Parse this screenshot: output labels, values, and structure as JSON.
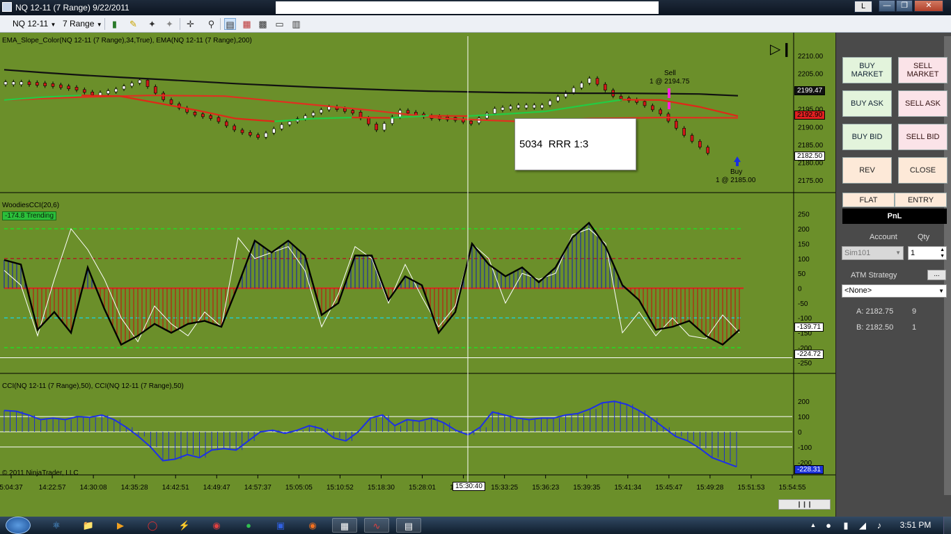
{
  "window": {
    "title": "NQ 12-11 (7 Range)  9/22/2011",
    "btn_l": "L"
  },
  "toolbar": {
    "instrument": "NQ 12-11",
    "period": "7 Range"
  },
  "price_panel": {
    "title": "EMA_Slope_Color(NQ 12-11 (7 Range),34,True), EMA(NQ 12-11 (7 Range),200)",
    "ticks": [
      "2210.00",
      "2205.00",
      "2200.00",
      "2195.00",
      "2190.00",
      "2185.00",
      "2180.00",
      "2175.00"
    ],
    "badge_ema200": "2199.47",
    "badge_ema34": "2192.90",
    "badge_last": "2182.50",
    "sell_label": "Sell",
    "sell_detail": "1 @ 2194.75",
    "buy_label": "Buy",
    "buy_detail": "1 @ 2185.00",
    "note_box": "5034  RRR 1:3"
  },
  "cci_panel": {
    "title": "WoodiesCCI(20,6)",
    "trend_badge": "-174.8 Trending",
    "ticks": [
      "250",
      "200",
      "150",
      "100",
      "50",
      "0",
      "-50",
      "-100",
      "-150",
      "-200",
      "-250"
    ],
    "badge_value": "-139.71",
    "badge_low": "-224.72"
  },
  "cci2_panel": {
    "title": "CCI(NQ 12-11 (7 Range),50), CCI(NQ 12-11 (7 Range),50)",
    "ticks": [
      "200",
      "100",
      "0",
      "-100",
      "-200"
    ],
    "badge_value": "-228.31",
    "copyright": "© 2011 NinjaTrader, LLC"
  },
  "time_axis": {
    "labels": [
      "5:04:37",
      "14:22:57",
      "14:30:08",
      "14:35:28",
      "14:42:51",
      "14:49:47",
      "14:57:37",
      "15:05:05",
      "15:10:52",
      "15:18:30",
      "15:28:01",
      "15:30:00",
      "15:33:25",
      "15:36:23",
      "15:39:35",
      "15:41:34",
      "15:45:47",
      "15:49:28",
      "15:51:53",
      "15:54:55"
    ],
    "cursor_label": "15:30:40"
  },
  "order_panel": {
    "buy_market": "BUY\nMARKET",
    "sell_market": "SELL\nMARKET",
    "buy_ask": "BUY ASK",
    "sell_ask": "SELL ASK",
    "buy_bid": "BUY BID",
    "sell_bid": "SELL BID",
    "rev": "REV",
    "close": "CLOSE",
    "flat": "FLAT",
    "entry": "ENTRY",
    "pnl": "PnL",
    "account_label": "Account",
    "account_value": "Sim101",
    "qty_label": "Qty",
    "qty_value": "1",
    "atm_label": "ATM Strategy",
    "atm_btn": "...",
    "atm_value": "<None>",
    "ask_label": "A: 2182.75",
    "ask_size": "9",
    "bid_label": "B: 2182.50",
    "bid_size": "1"
  },
  "taskbar": {
    "clock": "3:51 PM"
  },
  "chart_data": {
    "type": "line",
    "panels": [
      {
        "name": "price",
        "ylim": [
          2172.5,
          2212.5
        ],
        "ema200": [
          2206.0,
          2205.2,
          2204.5,
          2203.9,
          2203.3,
          2202.7,
          2202.1,
          2201.6,
          2201.1,
          2200.7,
          2200.3,
          2200.0,
          2199.8,
          2199.6,
          2199.5,
          2199.4,
          2199.4,
          2199.3,
          2199.2,
          2198.7
        ],
        "ema34": [
          2197.5,
          2198.3,
          2198.8,
          2198.6,
          2196.6,
          2194.6,
          2192.3,
          2191.5,
          2192.3,
          2192.6,
          2192.5,
          2193.1,
          2193.0,
          2193.6,
          2194.3,
          2196.0,
          2197.6,
          2197.5,
          2195.6,
          2193.0
        ],
        "closes": [
          2202.5,
          2202.0,
          2201.0,
          2199.0,
          2200.5,
          2203.0,
          2197.5,
          2194.0,
          2192.5,
          2189.0,
          2187.0,
          2190.5,
          2193.0,
          2195.5,
          2194.0,
          2189.0,
          2194.5,
          2193.0,
          2192.5,
          2191.0,
          2195.0,
          2196.0,
          2196.0,
          2199.5,
          2203.5,
          2198.5,
          2197.0,
          2193.5,
          2187.5,
          2182.5
        ]
      },
      {
        "name": "woodies_cci",
        "ylim": [
          -275,
          275
        ],
        "cci": [
          95,
          80,
          -140,
          -80,
          -150,
          70,
          -70,
          -190,
          -160,
          -120,
          -150,
          -120,
          -110,
          -130,
          10,
          160,
          120,
          160,
          110,
          -90,
          -50,
          110,
          110,
          -40,
          40,
          10,
          -150,
          -80,
          150,
          80,
          40,
          70,
          20,
          70,
          170,
          220,
          140,
          10,
          -40,
          -140,
          -130,
          -110,
          -160,
          -190,
          -140
        ],
        "turbo": [
          60,
          10,
          -160,
          30,
          200,
          130,
          30,
          -100,
          -180,
          -60,
          -120,
          -160,
          -80,
          -130,
          170,
          100,
          120,
          140,
          60,
          -130,
          -20,
          140,
          100,
          -50,
          80,
          -30,
          -130,
          -60,
          150,
          100,
          -50,
          50,
          30,
          50,
          180,
          200,
          150,
          -150,
          -80,
          -160,
          -100,
          -160,
          -170,
          -90,
          -150
        ]
      },
      {
        "name": "cci50",
        "ylim": [
          -265,
          265
        ],
        "values": [
          140,
          135,
          110,
          80,
          90,
          80,
          100,
          95,
          110,
          80,
          30,
          -30,
          -100,
          -190,
          -180,
          -150,
          -170,
          -120,
          -110,
          -120,
          -60,
          0,
          10,
          -10,
          10,
          40,
          20,
          -40,
          -60,
          0,
          90,
          110,
          40,
          80,
          70,
          90,
          60,
          10,
          -20,
          30,
          130,
          110,
          90,
          80,
          90,
          90,
          110,
          120,
          150,
          190,
          200,
          180,
          140,
          90,
          30,
          -30,
          -60,
          -110,
          -170,
          -200,
          -230
        ]
      }
    ]
  }
}
